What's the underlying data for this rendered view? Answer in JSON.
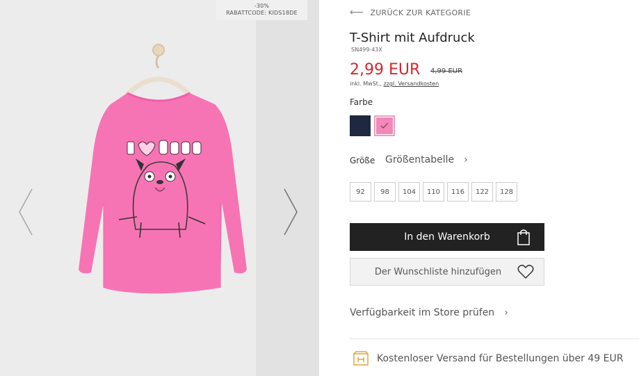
{
  "gallery": {
    "promo_discount": "-30%",
    "promo_code": "RABATTCODE: KIDS18DE",
    "prev_icon": "chevron-left-icon",
    "next_icon": "chevron-right-icon"
  },
  "product": {
    "back_label": "ZURÜCK ZUR KATEGORIE",
    "title": "T-Shirt mit Aufdruck",
    "sku": "SN499-43X",
    "price": "2,99 EUR",
    "old_price": "4,99 EUR",
    "tax_prefix": "inkl. MwSt.,",
    "tax_link": "zzgl. Versandkosten"
  },
  "colors": {
    "label": "Farbe",
    "swatches": [
      {
        "name": "navy",
        "hex": "#1e2840"
      },
      {
        "name": "pink",
        "hex": "#f287b8",
        "selected": true
      }
    ]
  },
  "sizes": {
    "label": "Größe",
    "chart_link": "Größentabelle",
    "options": [
      "92",
      "98",
      "104",
      "110",
      "116",
      "122",
      "128"
    ]
  },
  "actions": {
    "cart_label": "In den Warenkorb",
    "wishlist_label": "Der Wunschliste hinzufügen",
    "store_check": "Verfügbarkeit im Store prüfen"
  },
  "shipping": {
    "text": "Kostenloser Versand für Bestellungen über 49 EUR"
  },
  "theme": {
    "accent_red": "#d8262d",
    "button_dark": "#222222",
    "shipping_icon_color": "#e0a73a"
  }
}
